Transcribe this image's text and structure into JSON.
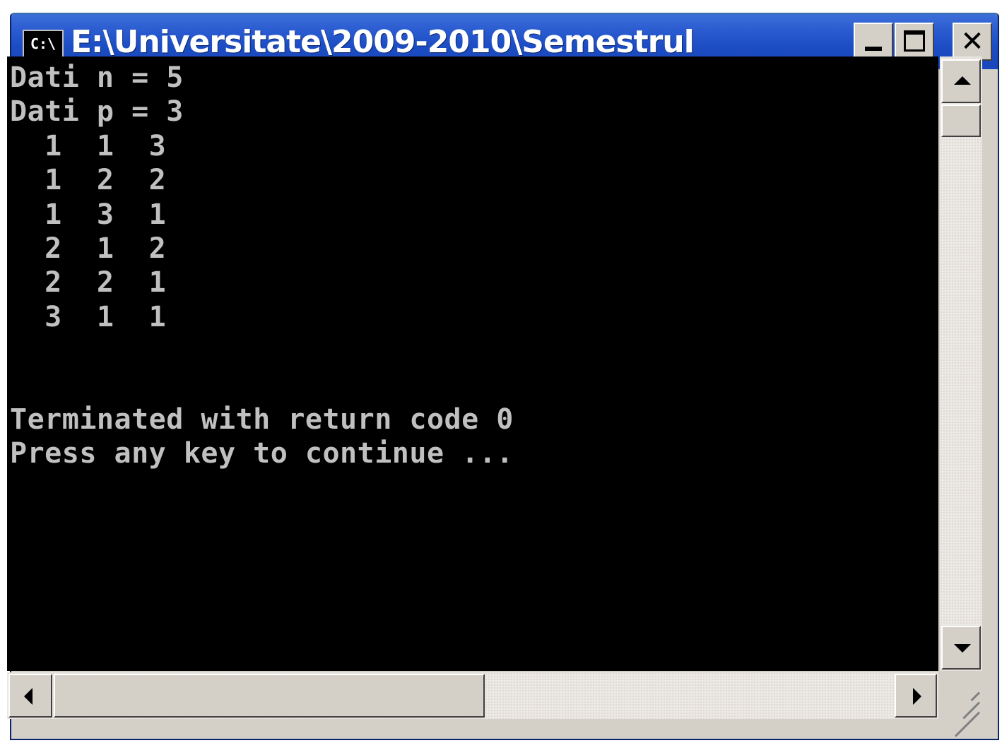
{
  "window": {
    "title": "E:\\Universitate\\2009-2010\\Semestrul",
    "icon_label": "C:\\",
    "icon": "console-app-icon",
    "controls": [
      "minimize-icon",
      "maximize-icon",
      "close-icon"
    ]
  },
  "console": {
    "lines": [
      "Dati n = 5",
      "Dati p = 3",
      "  1  1  3",
      "  1  2  2",
      "  1  3  1",
      "  2  1  2",
      "  2  2  1",
      "  3  1  1",
      "",
      "",
      "Terminated with return code 0",
      "Press any key to continue ..."
    ],
    "foreground": "#c0c0c0",
    "background": "#000000"
  },
  "colors": {
    "titlebar": "#1b4cc3",
    "chrome": "#d4d0c8"
  },
  "scrollbars": {
    "vertical_position": 0.0,
    "horizontal_position": 0.0
  }
}
